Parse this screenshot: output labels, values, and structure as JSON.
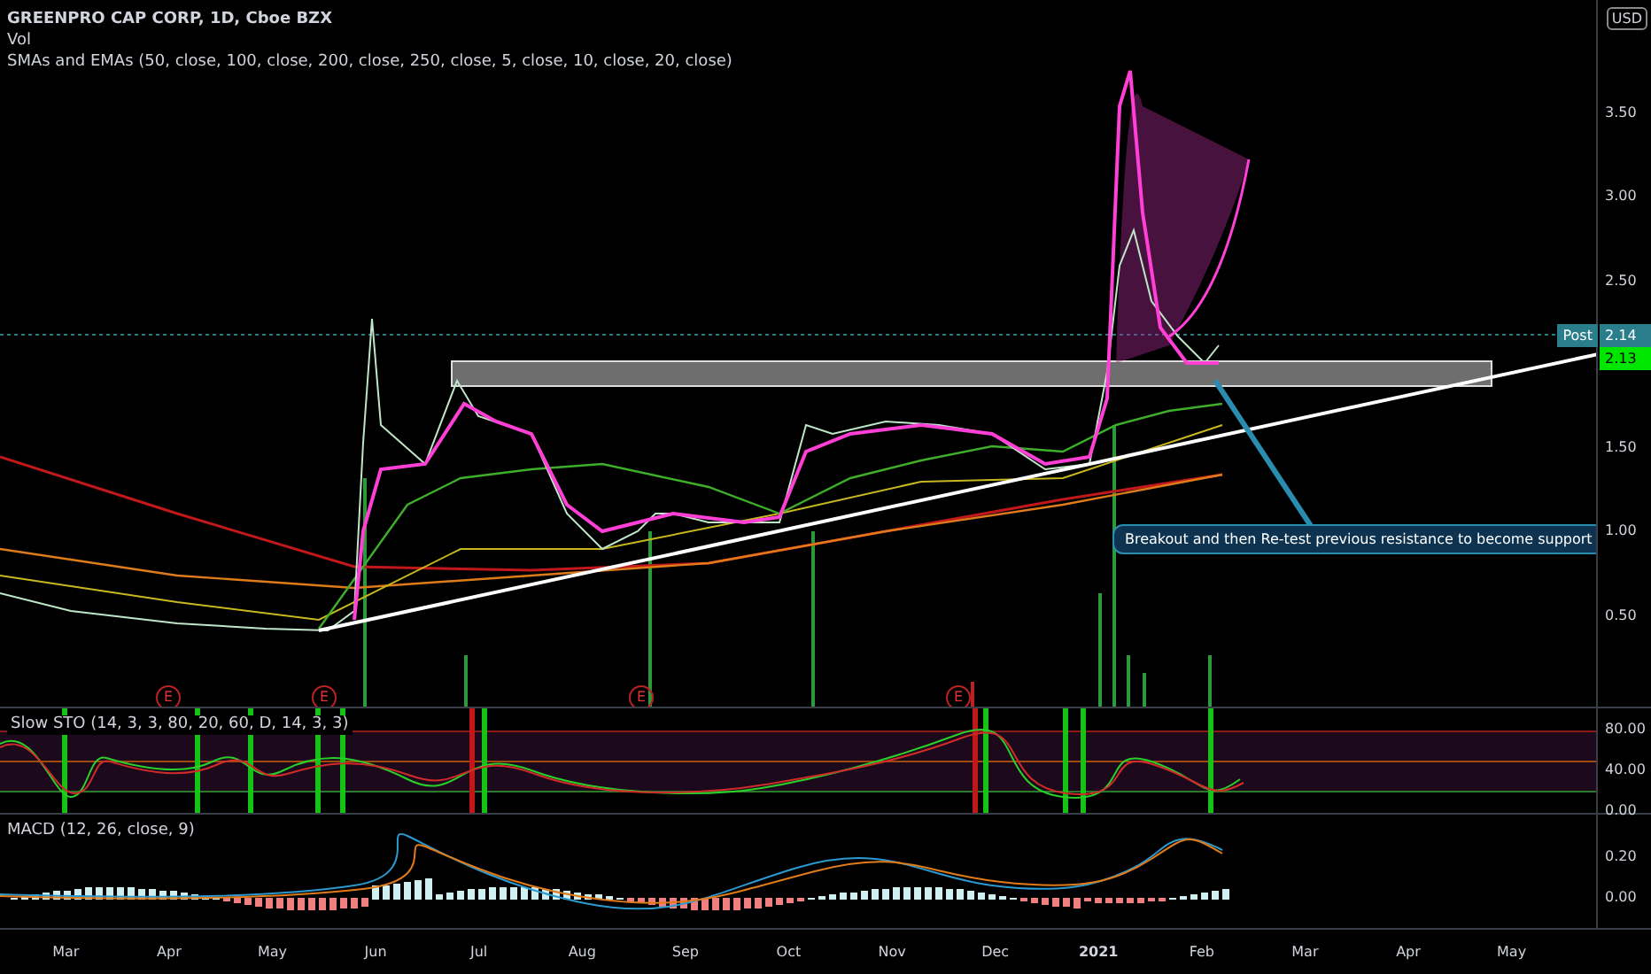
{
  "header": {
    "title": "GREENPRO CAP CORP, 1D, Cboe BZX",
    "indicators": [
      "Vol",
      "SMAs and EMAs (50, close, 100, close, 200, close, 250, close, 5, close, 10, close, 20, close)"
    ]
  },
  "currency": "USD",
  "price_axis": {
    "ticks": [
      "3.50",
      "3.00",
      "2.50",
      "1.50",
      "1.00",
      "0.50"
    ]
  },
  "price_labels": [
    {
      "kind": "post",
      "tag": "Post",
      "value": "2.14"
    },
    {
      "kind": "last",
      "value": "2.13"
    }
  ],
  "earnings_markers": [
    "E",
    "E",
    "E",
    "E"
  ],
  "annotation": {
    "text": "Breakout and then Re-test previous resistance to become support"
  },
  "stochastic": {
    "title": "Slow STO (14, 3, 3, 80, 20, 60, D, 14, 3, 3)",
    "ticks": [
      "80.00",
      "40.00",
      "0.00"
    ]
  },
  "macd": {
    "title": "MACD (12, 26, close, 9)",
    "ticks": [
      "0.20",
      "0.00"
    ]
  },
  "time_axis": [
    "Mar",
    "Apr",
    "May",
    "Jun",
    "Jul",
    "Aug",
    "Sep",
    "Oct",
    "Nov",
    "Dec",
    "2021",
    "Feb",
    "Mar",
    "Apr",
    "May"
  ]
}
